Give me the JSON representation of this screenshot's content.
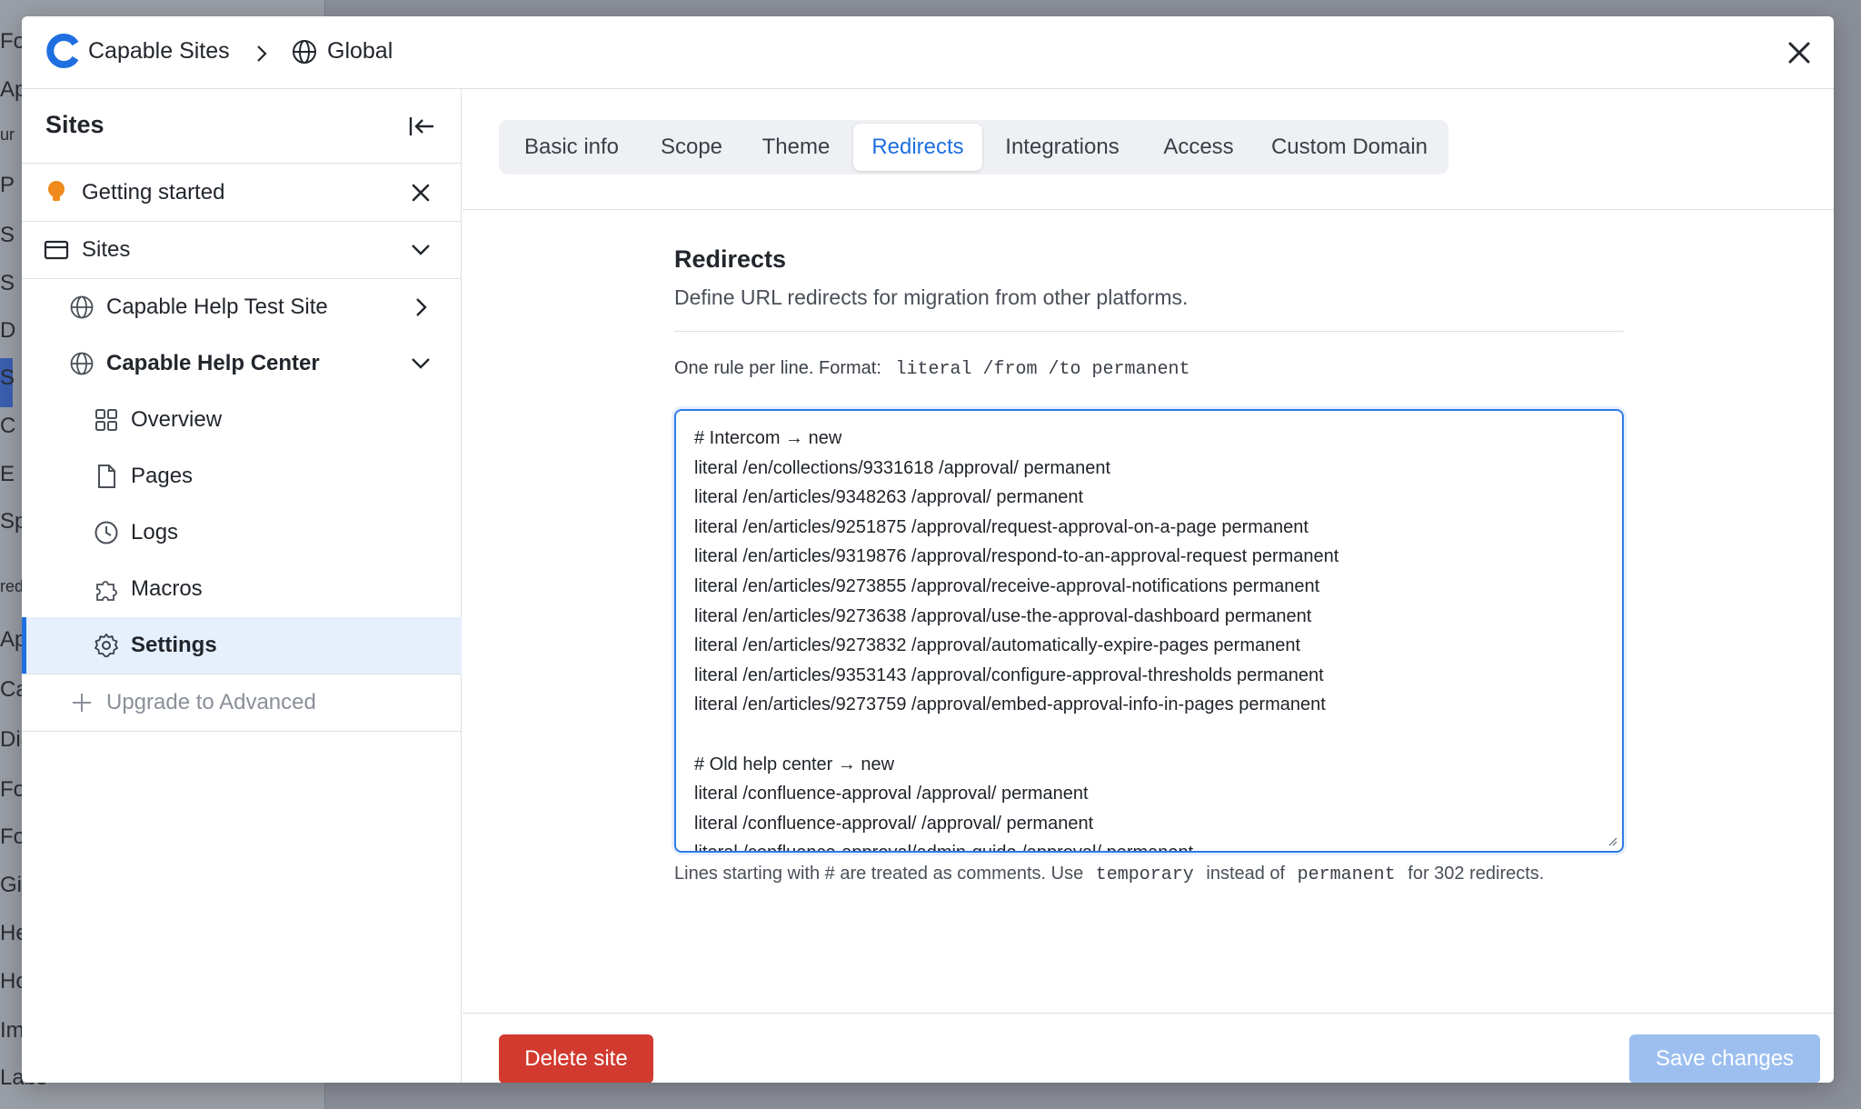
{
  "background": {
    "items": [
      "Fo",
      "Ap",
      "ur",
      "P",
      "S",
      "S",
      "D",
      "S",
      "C",
      "E",
      "Sp",
      "red",
      "Ap",
      "Ca",
      "Dia",
      "Fo",
      "Fo",
      "Git",
      "He",
      "Ho",
      "Im",
      "Labs"
    ]
  },
  "header": {
    "brand": "Capable Sites",
    "breadcrumb": "Global"
  },
  "sidebar": {
    "title": "Sites",
    "getting_started": "Getting started",
    "sites_label": "Sites",
    "site_test": "Capable Help Test Site",
    "site_center": "Capable Help Center",
    "overview": "Overview",
    "pages": "Pages",
    "logs": "Logs",
    "macros": "Macros",
    "settings": "Settings",
    "upgrade": "Upgrade to Advanced"
  },
  "tabs": [
    "Basic info",
    "Scope",
    "Theme",
    "Redirects",
    "Integrations",
    "Access",
    "Custom Domain"
  ],
  "active_tab": "Redirects",
  "redirects": {
    "title": "Redirects",
    "description": "Define URL redirects for migration from other platforms.",
    "format_prefix": "One rule per line. Format:",
    "format_code": "literal /from /to permanent",
    "rules": "# Intercom → new\nliteral /en/collections/9331618 /approval/ permanent\nliteral /en/articles/9348263 /approval/ permanent\nliteral /en/articles/9251875 /approval/request-approval-on-a-page permanent\nliteral /en/articles/9319876 /approval/respond-to-an-approval-request permanent\nliteral /en/articles/9273855 /approval/receive-approval-notifications permanent\nliteral /en/articles/9273638 /approval/use-the-approval-dashboard permanent\nliteral /en/articles/9273832 /approval/automatically-expire-pages permanent\nliteral /en/articles/9353143 /approval/configure-approval-thresholds permanent\nliteral /en/articles/9273759 /approval/embed-approval-info-in-pages permanent\n\n# Old help center → new\nliteral /confluence-approval /approval/ permanent\nliteral /confluence-approval/ /approval/ permanent\nliteral /confluence-approval/admin-guide /approval/ permanent",
    "help_prefix": "Lines starting with # are treated as comments. Use",
    "help_code_1": "temporary",
    "help_middle": "instead of",
    "help_code_2": "permanent",
    "help_suffix": "for 302 redirects."
  },
  "footer": {
    "delete_label": "Delete site",
    "save_label": "Save changes"
  },
  "colors": {
    "accent": "#1f6fe0",
    "danger": "#d23a2f",
    "save_disabled": "#9cbff0",
    "active_row": "#e6effc"
  }
}
